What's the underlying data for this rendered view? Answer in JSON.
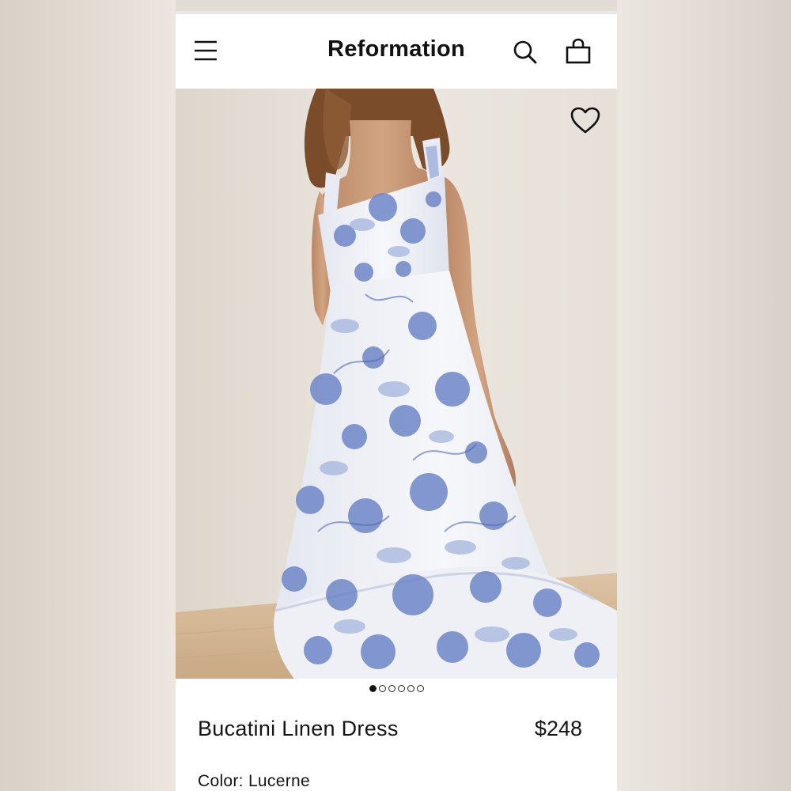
{
  "header": {
    "brand": "Reformation"
  },
  "icons": {
    "menu": "hamburger-menu-icon",
    "search": "search-icon",
    "bag": "shopping-bag-icon",
    "favorite": "heart-icon"
  },
  "gallery": {
    "total_images": 6,
    "current_index": 1
  },
  "product": {
    "name": "Bucatini Linen Dress",
    "price": "$248",
    "color_label": "Color:",
    "color_value": "Lucerne",
    "color_text": "Color: Lucerne"
  },
  "colors": {
    "wall": "#e9e4dd",
    "floor": "#d9bf9e",
    "dress_base": "#f2f3f7",
    "floral_blue": "#6f86c8",
    "text": "#151515"
  }
}
